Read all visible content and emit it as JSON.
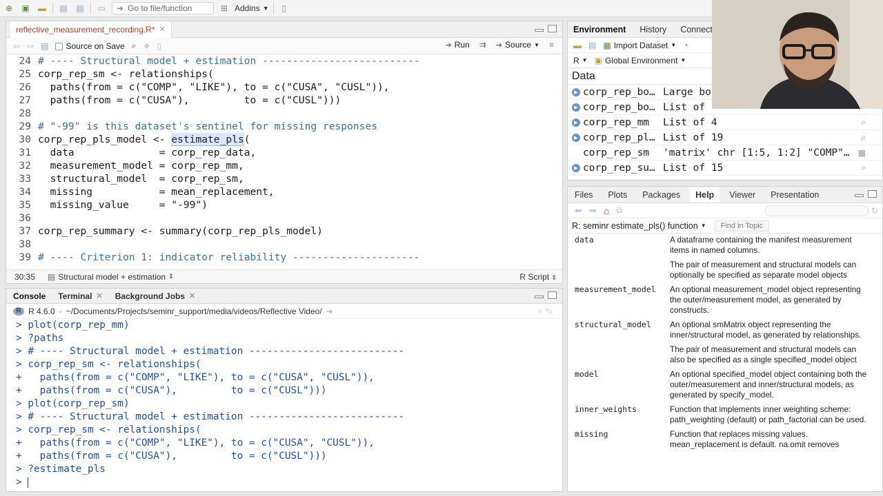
{
  "toolbar": {
    "goto_placeholder": "Go to file/function",
    "addins_label": "Addins"
  },
  "editor": {
    "tab_title": "reflective_measurement_recording.R*",
    "source_on_save_label": "Source on Save",
    "run_label": "Run",
    "source_label": "Source",
    "status_position": "30:35",
    "status_scope": "Structural model + estimation",
    "status_filetype": "R Script",
    "lines": [
      {
        "n": "24",
        "text": "# ---- Structural model + estimation --------------------------",
        "kind": "comment"
      },
      {
        "n": "25",
        "text": "corp_rep_sm <- relationships(",
        "kind": "code"
      },
      {
        "n": "26",
        "text": "  paths(from = c(\"COMP\", \"LIKE\"), to = c(\"CUSA\", \"CUSL\")),",
        "kind": "code"
      },
      {
        "n": "27",
        "text": "  paths(from = c(\"CUSA\"),         to = c(\"CUSL\")))",
        "kind": "code"
      },
      {
        "n": "28",
        "text": "",
        "kind": "code"
      },
      {
        "n": "29",
        "text": "# \"-99\" is this dataset's sentinel for missing responses",
        "kind": "comment"
      },
      {
        "n": "30",
        "text": "corp_rep_pls_model <- ",
        "kind": "code",
        "highlight": "estimate_pls",
        "after": "("
      },
      {
        "n": "31",
        "text": "  data              = corp_rep_data,",
        "kind": "code"
      },
      {
        "n": "32",
        "text": "  measurement_model = corp_rep_mm,",
        "kind": "code"
      },
      {
        "n": "33",
        "text": "  structural_model  = corp_rep_sm,",
        "kind": "code"
      },
      {
        "n": "34",
        "text": "  missing           = mean_replacement,",
        "kind": "code"
      },
      {
        "n": "35",
        "text": "  missing_value     = \"-99\")",
        "kind": "code"
      },
      {
        "n": "36",
        "text": "",
        "kind": "code"
      },
      {
        "n": "37",
        "text": "corp_rep_summary <- summary(corp_rep_pls_model)",
        "kind": "code"
      },
      {
        "n": "38",
        "text": "",
        "kind": "code"
      },
      {
        "n": "39",
        "text": "# ---- Criterion 1: indicator reliability ---------------------",
        "kind": "comment"
      }
    ]
  },
  "console": {
    "tabs": [
      "Console",
      "Terminal",
      "Background Jobs"
    ],
    "r_version": "R 4.6.0",
    "path": "~/Documents/Projects/seminr_support/media/videos/Reflective Video/",
    "lines": [
      "> plot(corp_rep_mm)",
      "> ?paths",
      "> # ---- Structural model + estimation --------------------------",
      "> corp_rep_sm <- relationships(",
      "+   paths(from = c(\"COMP\", \"LIKE\"), to = c(\"CUSA\", \"CUSL\")),",
      "+   paths(from = c(\"CUSA\"),         to = c(\"CUSL\")))",
      "> plot(corp_rep_sm)",
      "> # ---- Structural model + estimation --------------------------",
      "> corp_rep_sm <- relationships(",
      "+   paths(from = c(\"COMP\", \"LIKE\"), to = c(\"CUSA\", \"CUSL\")),",
      "+   paths(from = c(\"CUSA\"),         to = c(\"CUSL\")))",
      "> ?estimate_pls",
      "> "
    ]
  },
  "environment": {
    "tabs": [
      "Environment",
      "History",
      "Connecti"
    ],
    "import_label": "Import Dataset",
    "lang_label": "R",
    "scope_label": "Global Environment",
    "data_header": "Data",
    "rows": [
      {
        "name": "corp_rep_bo…",
        "value": "Large boo",
        "icon": true,
        "mag": false
      },
      {
        "name": "corp_rep_bo…",
        "value": "List of",
        "icon": true,
        "mag": false
      },
      {
        "name": "corp_rep_mm",
        "value": "List of  4",
        "icon": true,
        "mag": true
      },
      {
        "name": "corp_rep_pl…",
        "value": "List of  19",
        "icon": true,
        "mag": true
      },
      {
        "name": "corp_rep_sm",
        "value": "'matrix' chr [1:5, 1:2] \"COMP\"…",
        "icon": false,
        "mag": false
      },
      {
        "name": "corp_rep_su…",
        "value": "List of  15",
        "icon": true,
        "mag": true
      }
    ]
  },
  "help": {
    "tabs": [
      "Files",
      "Plots",
      "Packages",
      "Help",
      "Viewer",
      "Presentation"
    ],
    "topic": "R: seminr estimate_pls() function",
    "find_label": "Find in Topic",
    "args": [
      {
        "name": "data",
        "paras": [
          "A dataframe containing the manifest measurement items in named columns.",
          "The pair of measurement and structural models can optionally be specified as separate model objects"
        ]
      },
      {
        "name": "measurement_model",
        "paras": [
          "An optional measurement_model object representing the outer/measurement model, as generated by constructs."
        ]
      },
      {
        "name": "structural_model",
        "paras": [
          "An optional smMatrix object representing the inner/structural model, as generated by relationships.",
          "The pair of measurement and structural models can also be specified as a single specified_model object"
        ]
      },
      {
        "name": "model",
        "paras": [
          "An optional specified_model object containing both the outer/measurement and inner/structural models, as generated by specify_model."
        ]
      },
      {
        "name": "inner_weights",
        "paras": [
          "Function that implements inner weighting scheme: path_weighting (default) or path_factorial can be used."
        ]
      },
      {
        "name": "missing",
        "paras": [
          "Function that replaces missing values. mean_replacement is default. na.omit removes"
        ]
      }
    ]
  }
}
